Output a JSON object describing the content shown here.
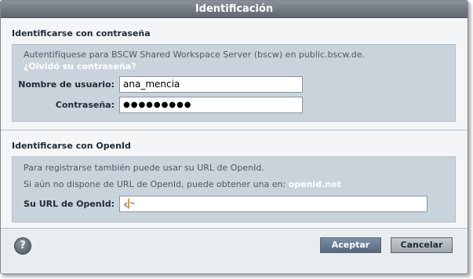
{
  "dialog": {
    "title": "Identificación"
  },
  "password_section": {
    "title": "Identificarse con contraseña",
    "info": "Autentifíquese para BSCW Shared Workspace Server (bscw) en public.bscw.de.",
    "forgot_link": "¿Olvidó su contraseña?",
    "username_label": "Nombre de usuario:",
    "username_value": "ana_mencia",
    "password_label": "Contraseña:",
    "password_value": "●●●●●●●●●"
  },
  "openid_section": {
    "title": "Identificarse con OpenId",
    "info1": "Para registrarse también puede usar su URL de OpenId.",
    "info2": "Si aún no dispone de URL de OpenId, puede obtener una en:",
    "openid_link": "openid.net",
    "url_label": "Su URL de OpenId:",
    "url_value": ""
  },
  "footer": {
    "help_label": "?",
    "accept_label": "Aceptar",
    "cancel_label": "Cancelar"
  },
  "colors": {
    "titlebar": "#6b727b",
    "panel": "#c9d3db",
    "accept_button": "#6a7c93",
    "openid_icon": "#f7931e"
  }
}
